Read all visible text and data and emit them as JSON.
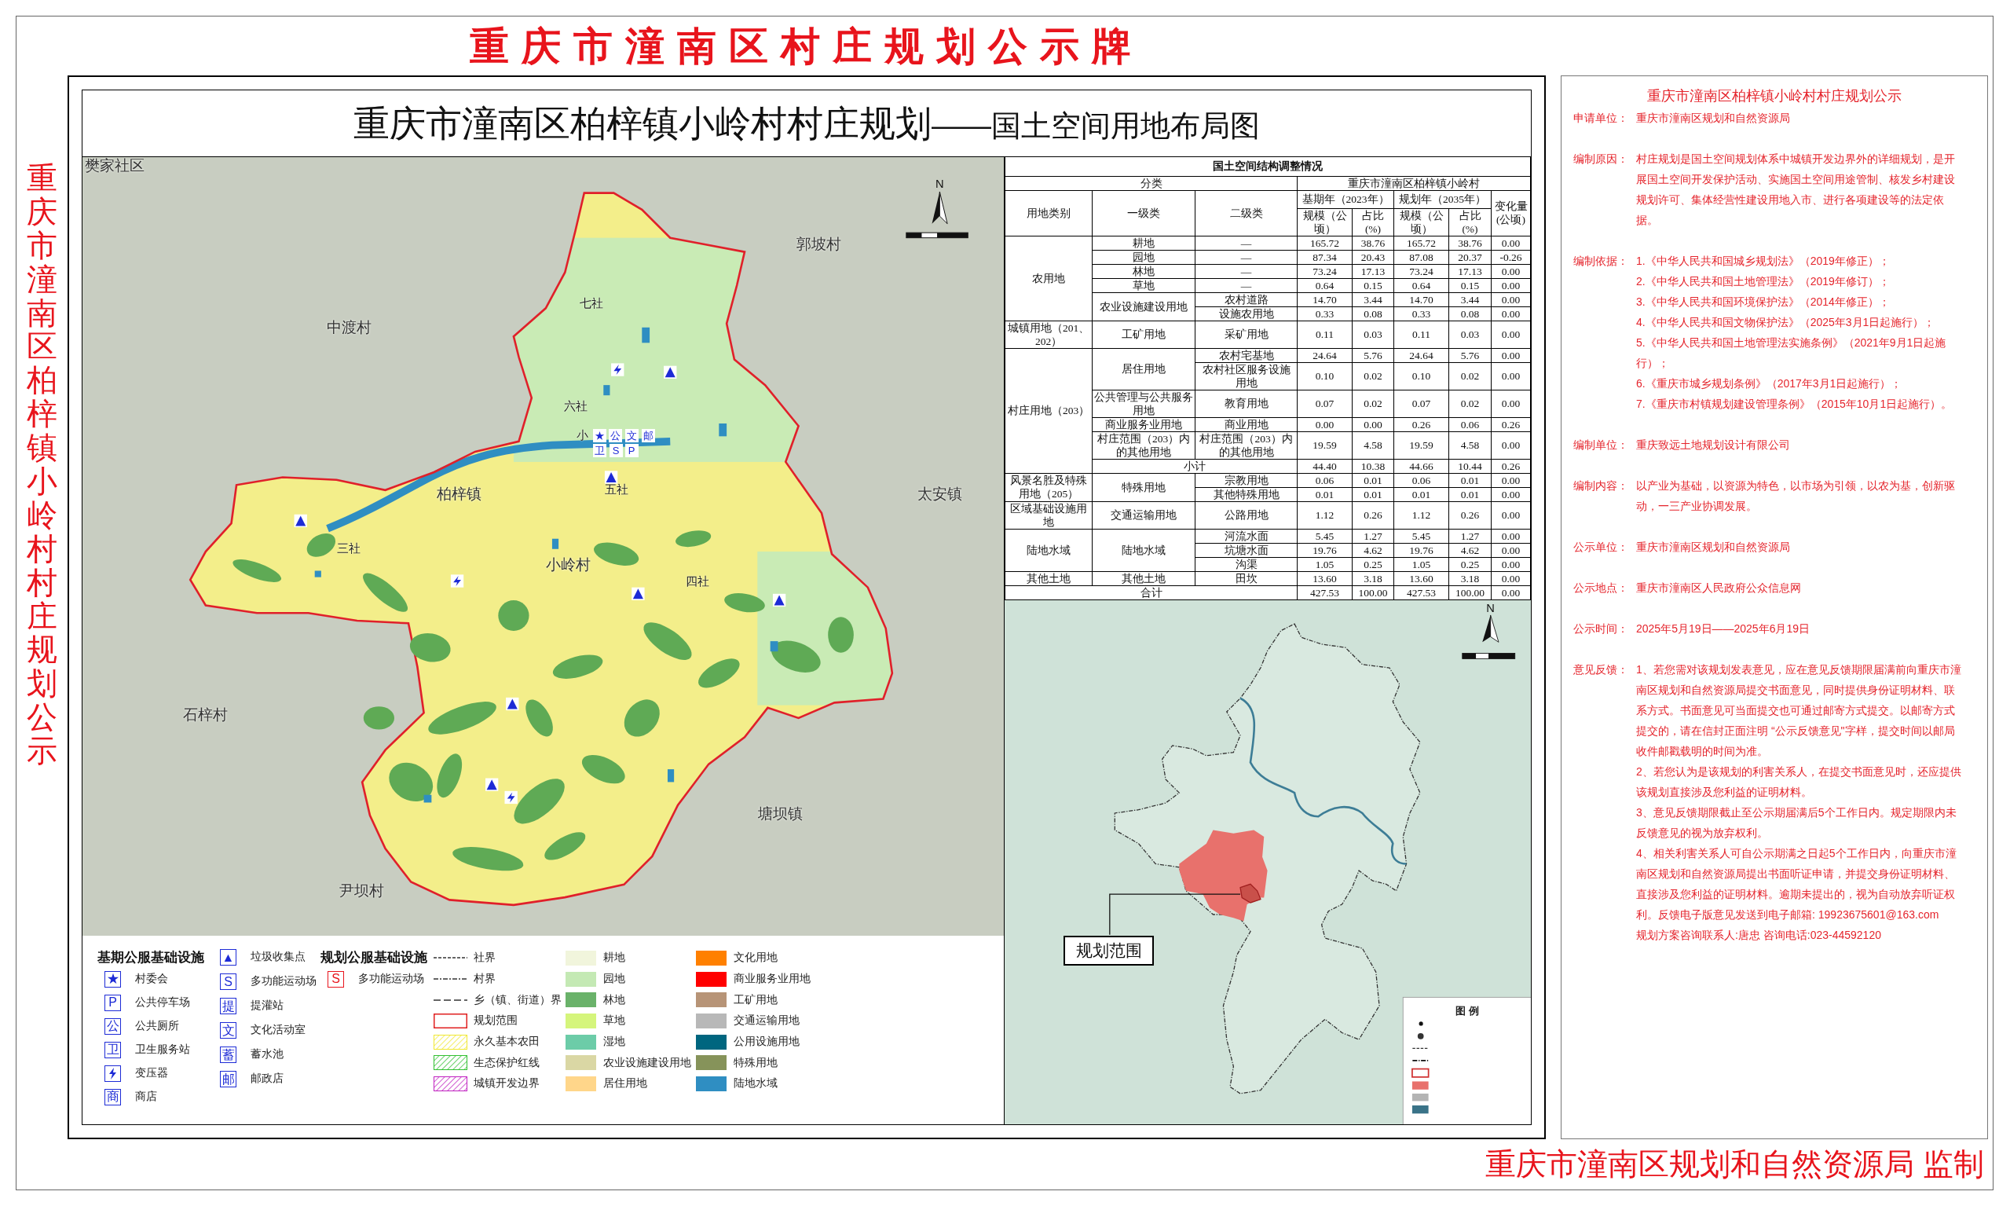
{
  "board_title": "重庆市潼南区村庄规划公示牌",
  "side_title": "重庆市潼南区柏梓镇小岭村村庄规划公示",
  "map_panel": {
    "title": "重庆市潼南区柏梓镇小岭村村庄规划",
    "subtitle": "——国土空间用地布局图",
    "map": {
      "north_label": "N",
      "place_labels": [
        "樊家社区",
        "郭坡村",
        "中渡村",
        "柏梓镇",
        "太安镇",
        "小岭村",
        "石梓村",
        "塘坝镇",
        "尹坝村"
      ],
      "area_labels": [
        "七社",
        "六社",
        "五社",
        "四社",
        "三社",
        "小"
      ],
      "symbol_cluster": [
        "★",
        "公",
        "文",
        "邮",
        "卫",
        "S",
        "P"
      ]
    },
    "legend": {
      "existing_facilities": {
        "title": "基期公服基础设施",
        "items": [
          {
            "kind": "glyph",
            "symbol": "★",
            "label": "村委会"
          },
          {
            "kind": "glyph",
            "symbol": "P",
            "label": "公共停车场"
          },
          {
            "kind": "glyph",
            "symbol": "公",
            "label": "公共厕所"
          },
          {
            "kind": "glyph",
            "symbol": "卫",
            "label": "卫生服务站"
          },
          {
            "kind": "bolt",
            "label": "变压器"
          },
          {
            "kind": "glyph",
            "symbol": "商",
            "label": "商店"
          },
          {
            "kind": "glyph",
            "symbol": "▲",
            "label": "垃圾收集点"
          },
          {
            "kind": "glyph",
            "symbol": "S",
            "label": "多功能运动场"
          },
          {
            "kind": "glyph",
            "symbol": "提",
            "label": "提灌站"
          },
          {
            "kind": "glyph",
            "symbol": "文",
            "label": "文化活动室"
          },
          {
            "kind": "glyph",
            "symbol": "蓄",
            "label": "蓄水池"
          },
          {
            "kind": "glyph",
            "symbol": "邮",
            "label": "邮政店"
          }
        ]
      },
      "planned_facilities": {
        "title": "规划公服基础设施",
        "items": [
          {
            "kind": "glyph",
            "symbol": "S",
            "label": "多功能运动场"
          }
        ]
      },
      "boundaries": [
        {
          "kind": "dashed",
          "label": "社界"
        },
        {
          "kind": "dashdot",
          "label": "村界"
        },
        {
          "kind": "longdash",
          "label": "乡（镇、街道）界"
        },
        {
          "kind": "outline",
          "color": "#e02020",
          "label": "规划范围"
        },
        {
          "kind": "hatch",
          "color": "#f0e830",
          "label": "永久基本农田"
        },
        {
          "kind": "hatch",
          "color": "#30c030",
          "label": "生态保护红线"
        },
        {
          "kind": "hatch",
          "color": "#c020c0",
          "label": "城镇开发边界"
        }
      ],
      "land_use": [
        {
          "color": "#f1f5dc",
          "label": "耕地"
        },
        {
          "color": "#c4e9b4",
          "label": "园地"
        },
        {
          "color": "#6ab26a",
          "label": "林地"
        },
        {
          "color": "#d5f57c",
          "label": "草地"
        },
        {
          "color": "#6ccca8",
          "label": "湿地"
        },
        {
          "color": "#dad7a4",
          "label": "农业设施建设用地"
        },
        {
          "color": "#ffd68a",
          "label": "居住用地"
        },
        {
          "color": "#ff8000",
          "label": "文化用地"
        },
        {
          "color": "#ff0000",
          "label": "商业服务业用地"
        },
        {
          "color": "#b79477",
          "label": "工矿用地"
        },
        {
          "color": "#b8b8b8",
          "label": "交通运输用地"
        },
        {
          "color": "#00667f",
          "label": "公用设施用地"
        },
        {
          "color": "#86935a",
          "label": "特殊用地"
        },
        {
          "color": "#2f8ec2",
          "label": "陆地水域"
        }
      ]
    },
    "table": {
      "title": "国土空间结构调整情况",
      "classification": "分类",
      "region": "重庆市潼南区柏梓镇小岭村",
      "category_columns": [
        "用地类别",
        "一级类",
        "二级类"
      ],
      "periods": [
        {
          "label": "基期年（2023年）",
          "columns": [
            "规模（公顷）",
            "占比(%)"
          ]
        },
        {
          "label": "规划年（2035年）",
          "columns": [
            "规模（公顷）",
            "占比(%)"
          ]
        }
      ],
      "change_label": "变化量(公顷)",
      "groups": [
        {
          "category": "农用地",
          "subgroups": [
            {
              "level1": "耕地",
              "rows": [
                {
                  "level2": "—",
                  "values": [
                    "165.72",
                    "38.76",
                    "165.72",
                    "38.76",
                    "0.00"
                  ]
                }
              ]
            },
            {
              "level1": "园地",
              "rows": [
                {
                  "level2": "—",
                  "values": [
                    "87.34",
                    "20.43",
                    "87.08",
                    "20.37",
                    "-0.26"
                  ]
                }
              ]
            },
            {
              "level1": "林地",
              "rows": [
                {
                  "level2": "—",
                  "values": [
                    "73.24",
                    "17.13",
                    "73.24",
                    "17.13",
                    "0.00"
                  ]
                }
              ]
            },
            {
              "level1": "草地",
              "rows": [
                {
                  "level2": "—",
                  "values": [
                    "0.64",
                    "0.15",
                    "0.64",
                    "0.15",
                    "0.00"
                  ]
                }
              ]
            },
            {
              "level1": "农业设施建设用地",
              "rows": [
                {
                  "level2": "农村道路",
                  "values": [
                    "14.70",
                    "3.44",
                    "14.70",
                    "3.44",
                    "0.00"
                  ]
                },
                {
                  "level2": "设施农用地",
                  "values": [
                    "0.33",
                    "0.08",
                    "0.33",
                    "0.08",
                    "0.00"
                  ]
                }
              ]
            }
          ]
        },
        {
          "category": "城镇用地（201、202）",
          "subgroups": [
            {
              "level1": "工矿用地",
              "rows": [
                {
                  "level2": "采矿用地",
                  "values": [
                    "0.11",
                    "0.03",
                    "0.11",
                    "0.03",
                    "0.00"
                  ]
                }
              ]
            }
          ]
        },
        {
          "category": "村庄用地（203）",
          "subgroups": [
            {
              "level1": "居住用地",
              "rows": [
                {
                  "level2": "农村宅基地",
                  "values": [
                    "24.64",
                    "5.76",
                    "24.64",
                    "5.76",
                    "0.00"
                  ]
                },
                {
                  "level2": "农村社区服务设施用地",
                  "values": [
                    "0.10",
                    "0.02",
                    "0.10",
                    "0.02",
                    "0.00"
                  ]
                }
              ]
            },
            {
              "level1": "公共管理与公共服务用地",
              "rows": [
                {
                  "level2": "教育用地",
                  "values": [
                    "0.07",
                    "0.02",
                    "0.07",
                    "0.02",
                    "0.00"
                  ]
                }
              ]
            },
            {
              "level1": "商业服务业用地",
              "rows": [
                {
                  "level2": "商业用地",
                  "values": [
                    "0.00",
                    "0.00",
                    "0.26",
                    "0.06",
                    "0.26"
                  ]
                }
              ]
            },
            {
              "level1": "村庄范围（203）内的其他用地",
              "rows": [
                {
                  "level2": "村庄范围（203）内的其他用地",
                  "values": [
                    "19.59",
                    "4.58",
                    "19.59",
                    "4.58",
                    "0.00"
                  ]
                }
              ]
            }
          ],
          "subtotal": {
            "label": "小计",
            "values": [
              "44.40",
              "10.38",
              "44.66",
              "10.44",
              "0.26"
            ]
          }
        },
        {
          "category": "风景名胜及特殊用地（205）",
          "subgroups": [
            {
              "level1": "特殊用地",
              "rows": [
                {
                  "level2": "宗教用地",
                  "values": [
                    "0.06",
                    "0.01",
                    "0.06",
                    "0.01",
                    "0.00"
                  ]
                },
                {
                  "level2": "其他特殊用地",
                  "values": [
                    "0.01",
                    "0.01",
                    "0.01",
                    "0.01",
                    "0.00"
                  ]
                }
              ]
            }
          ]
        },
        {
          "category": "区域基础设施用地",
          "subgroups": [
            {
              "level1": "交通运输用地",
              "rows": [
                {
                  "level2": "公路用地",
                  "values": [
                    "1.12",
                    "0.26",
                    "1.12",
                    "0.26",
                    "0.00"
                  ]
                }
              ]
            }
          ]
        },
        {
          "category": "陆地水域",
          "subgroups": [
            {
              "level1": "陆地水域",
              "rows": [
                {
                  "level2": "河流水面",
                  "values": [
                    "5.45",
                    "1.27",
                    "5.45",
                    "1.27",
                    "0.00"
                  ]
                },
                {
                  "level2": "坑塘水面",
                  "values": [
                    "19.76",
                    "4.62",
                    "19.76",
                    "4.62",
                    "0.00"
                  ]
                },
                {
                  "level2": "沟渠",
                  "values": [
                    "1.05",
                    "0.25",
                    "1.05",
                    "0.25",
                    "0.00"
                  ]
                }
              ]
            }
          ]
        },
        {
          "category": "其他土地",
          "subgroups": [
            {
              "level1": "其他土地",
              "rows": [
                {
                  "level2": "田坎",
                  "values": [
                    "13.60",
                    "3.18",
                    "13.60",
                    "3.18",
                    "0.00"
                  ]
                }
              ]
            }
          ]
        }
      ],
      "total": {
        "label": "合计",
        "values": [
          "427.53",
          "100.00",
          "427.53",
          "100.00",
          "0.00"
        ]
      }
    },
    "location_map": {
      "north_label": "N",
      "callout": "规划范围",
      "legend_title": "图 例"
    }
  },
  "notice": {
    "title": "重庆市潼南区柏梓镇小岭村村庄规划公示",
    "sections": [
      {
        "kind": "text",
        "label": "申请单位：",
        "text": "重庆市潼南区规划和自然资源局"
      },
      {
        "kind": "text",
        "label": "编制原因：",
        "text": "村庄规划是国土空间规划体系中城镇开发边界外的详细规划，是开展国土空间开发保护活动、实施国土空间用途管制、核发乡村建设规划许可、集体经营性建设用地入市、进行各项建设等的法定依据。"
      },
      {
        "kind": "list",
        "label": "编制依据：",
        "items": [
          "1.《中华人民共和国城乡规划法》（2019年修正）；",
          "2.《中华人民共和国土地管理法》（2019年修订）；",
          "3.《中华人民共和国环境保护法》（2014年修正）；",
          "4.《中华人民共和国文物保护法》（2025年3月1日起施行）；",
          "5.《中华人民共和国土地管理法实施条例》（2021年9月1日起施行）；",
          "6.《重庆市城乡规划条例》（2017年3月1日起施行）；",
          "7.《重庆市村镇规划建设管理条例》（2015年10月1日起施行）。"
        ]
      },
      {
        "kind": "text",
        "label": "编制单位：",
        "text": "重庆致远土地规划设计有限公司"
      },
      {
        "kind": "text",
        "label": "编制内容：",
        "text": "以产业为基础，以资源为特色，以市场为引领，以农为基，创新驱动，一三产业协调发展。"
      },
      {
        "kind": "text",
        "label": "公示单位：",
        "text": "重庆市潼南区规划和自然资源局"
      },
      {
        "kind": "text",
        "label": "公示地点：",
        "text": "重庆市潼南区人民政府公众信息网"
      },
      {
        "kind": "text",
        "label": "公示时间：",
        "text": "2025年5月19日——2025年6月19日"
      },
      {
        "kind": "list",
        "label": "意见反馈：",
        "items": [
          "1、若您需对该规划发表意见，应在意见反馈期限届满前向重庆市潼南区规划和自然资源局提交书面意见，同时提供身份证明材料、联系方式。书面意见可当面提交也可通过邮寄方式提交。以邮寄方式提交的，请在信封正面注明 “公示反馈意见\"字样，提交时间以邮局收件邮戳载明的时间为准。",
          "2、若您认为是该规划的利害关系人，在提交书面意见时，还应提供该规划直接涉及您利益的证明材料。",
          "3、意见反馈期限截止至公示期届满后5个工作日内。规定期限内未反馈意见的视为放弃权利。",
          "4、相关利害关系人可自公示期满之日起5个工作日内，向重庆市潼南区规划和自然资源局提出书面听证申请，并提交身份证明材料、直接涉及您利益的证明材料。逾期未提出的，视为自动放弃听证权利。反馈电子版意见发送到电子邮箱: 19923675601@163.com",
          "规划方案咨询联系人:唐忠 咨询电话:023-44592120"
        ]
      }
    ]
  },
  "footer": "重庆市潼南区规划和自然资源局 监制"
}
